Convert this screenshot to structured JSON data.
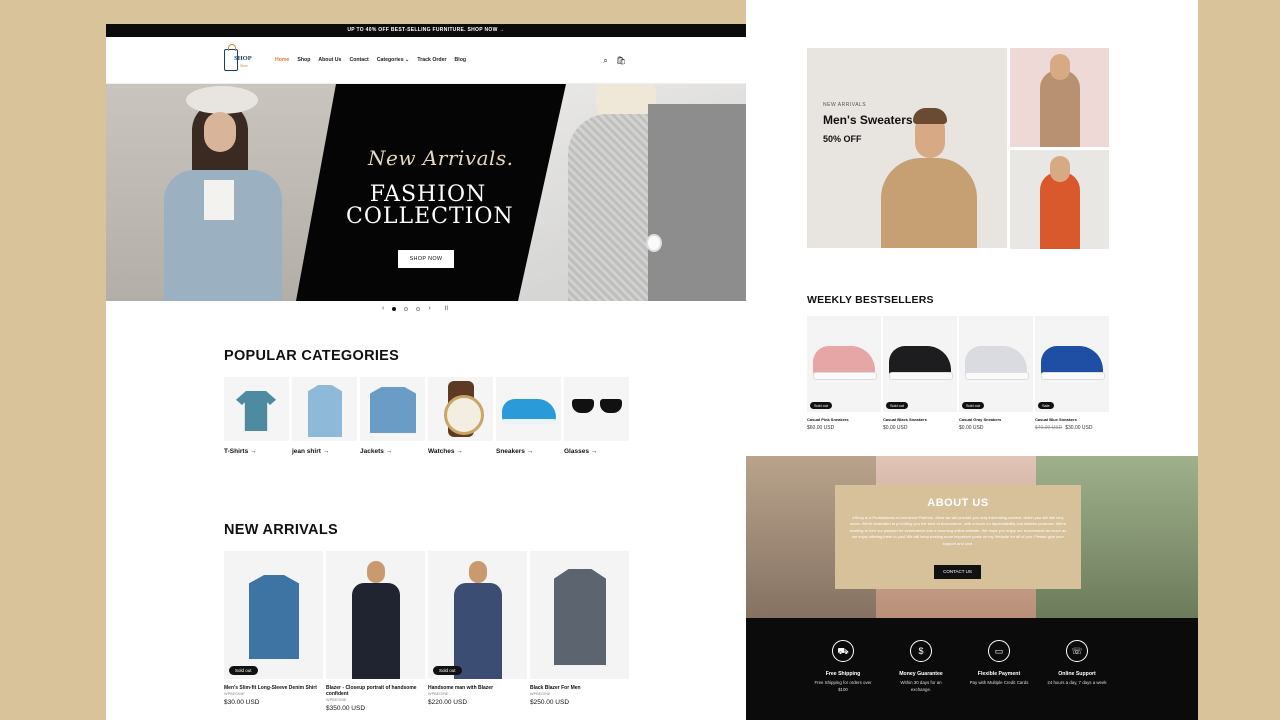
{
  "colors": {
    "background": "#d9c39b",
    "accent": "#e07b39",
    "dark": "#0b0b0b",
    "about_box": "#d7c19b"
  },
  "announcement": "UP TO 40% OFF BEST-SELLING FURNITURE. SHOP NOW →",
  "logo": {
    "word": "SHOP",
    "sub": "Store"
  },
  "nav": [
    "Home",
    "Shop",
    "About Us",
    "Contact",
    "Categories ⌄",
    "Track Order",
    "Blog"
  ],
  "header_icons": [
    "search-icon",
    "cart-icon"
  ],
  "hero": {
    "script": "New Arrivals.",
    "title_line1": "FASHION",
    "title_line2": "COLLECTION",
    "button": "SHOP NOW"
  },
  "slider": {
    "prev": "‹",
    "next": "›",
    "pause": "II",
    "slides": 3,
    "active": 1
  },
  "popular": {
    "title": "POPULAR CATEGORIES",
    "items": [
      {
        "label": "T-Shirts →"
      },
      {
        "label": "jean shirt →"
      },
      {
        "label": "Jackets →"
      },
      {
        "label": "Watches →"
      },
      {
        "label": "Sneakers →"
      },
      {
        "label": "Glasses →"
      }
    ]
  },
  "arrivals": {
    "title": "NEW ARRIVALS",
    "items": [
      {
        "name": "Men's Slim-fit Long-Sleeve Denim Shirt",
        "vendor": "WPBEGINE",
        "price": "$30.00 USD",
        "badge": "Sold out"
      },
      {
        "name": "Blazer - Closeup portrait of handsome confident",
        "vendor": "WPBEGINE",
        "price": "$350.00 USD",
        "badge": ""
      },
      {
        "name": "Handsome man with Blazer",
        "vendor": "WPBEGINE",
        "price": "$220.00 USD",
        "badge": "Sold out"
      },
      {
        "name": "Black Blazer For Men",
        "vendor": "WPBEGINE",
        "price": "$250.00 USD",
        "badge": ""
      }
    ]
  },
  "promo": {
    "kicker": "NEW ARRIVALS",
    "title": "Men's Sweaters",
    "offer": "50% OFF"
  },
  "bestsellers": {
    "title": "WEEKLY BESTSELLERS",
    "items": [
      {
        "name": "Casual Pink Sneakers",
        "price": "$60.00 USD",
        "old_price": "",
        "badge": "Sold out",
        "color": "#e6a6a6"
      },
      {
        "name": "Casual Black Sneakers",
        "price": "$0.00 USD",
        "old_price": "",
        "badge": "Sold out",
        "color": "#1d1d1f"
      },
      {
        "name": "Casual Gray Sneakers",
        "price": "$0.00 USD",
        "old_price": "",
        "badge": "Sold out",
        "color": "#d9dbe0"
      },
      {
        "name": "Casual Blue Sneakers",
        "price": "$30.00 USD",
        "old_price": "$40.00 USD",
        "badge": "Sale",
        "color": "#1f4fa5"
      }
    ]
  },
  "about": {
    "title": "ABOUT US",
    "text": "eShop is a Professional eCommerce Platform. Here we will provide you only interesting content, which you will like very much. We're dedicated to providing you the best of ecommerce, with a focus on dependability and fashion products. We're working to turn our passion for ecommerce into a booming online website. We hope you enjoy our ecommerce as much as we enjoy offering them to you! We will keep posting more important posts on my Website for all of you. Please give your support and love.",
    "button": "CONTACT US"
  },
  "features": [
    {
      "icon": "truck-icon",
      "glyph": "⛟",
      "title": "Free Shipping",
      "desc": "Free Shipping for orders over $100"
    },
    {
      "icon": "money-icon",
      "glyph": "$",
      "title": "Money Guarantee",
      "desc": "Within 30 days for an exchange."
    },
    {
      "icon": "payment-icon",
      "glyph": "▭",
      "title": "Flexible Payment",
      "desc": "Pay with Multiple Credit Cards"
    },
    {
      "icon": "support-icon",
      "glyph": "☏",
      "title": "Online Support",
      "desc": "24 hours a day, 7 days a week"
    }
  ]
}
